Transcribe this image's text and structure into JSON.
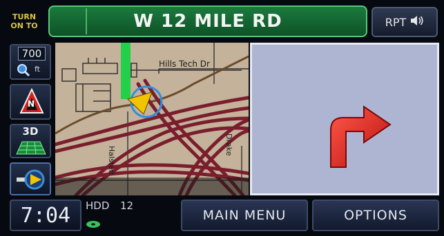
{
  "header": {
    "turn_label_line1": "TURN",
    "turn_label_line2": "ON TO",
    "street_name": "W 12 MILE RD",
    "repeat_label": "RPT"
  },
  "sidebar": {
    "scale_value": "700",
    "scale_unit": "ft",
    "view_3d_label": "3D",
    "north_label": "N"
  },
  "map": {
    "street_labels": [
      "Hills Tech Dr",
      "Halsted",
      "Drake"
    ],
    "route_color": "#22d04a",
    "road_color": "#7a1e2e"
  },
  "guidance": {
    "direction": "right-turn",
    "arrow_color": "#e8261e",
    "panel_color": "#aeb5d3"
  },
  "footer": {
    "clock": "7:04",
    "hdd_label": "HDD",
    "hdd_value": "12",
    "main_menu_label": "MAIN MENU",
    "options_label": "OPTIONS"
  },
  "icons": [
    "speaker-icon",
    "zoom-icon",
    "north-arrow-icon",
    "grid-3d-icon",
    "vehicle-position-icon",
    "disc-icon",
    "turn-arrow-icon"
  ]
}
